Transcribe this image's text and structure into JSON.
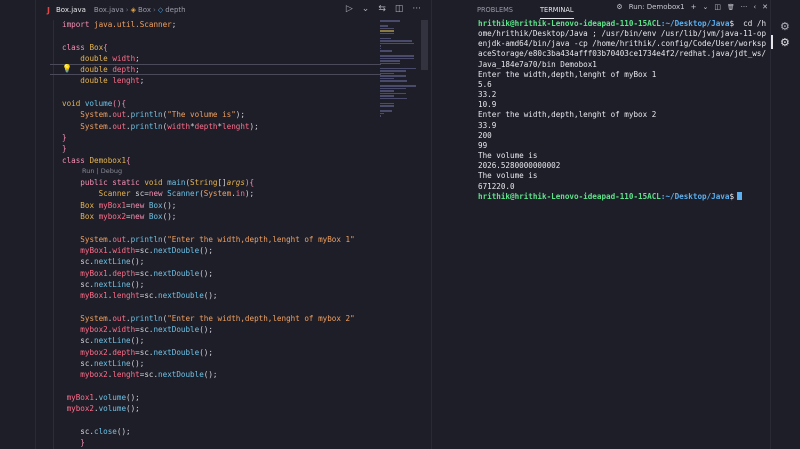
{
  "editor": {
    "tab": {
      "language_icon": "J",
      "file_name": "Box.java",
      "breadcrumb_file": "Box.java",
      "breadcrumb_class": "Box",
      "breadcrumb_field": "depth"
    },
    "actions": {
      "run_icon": "▷",
      "run_dropdown": "⌄",
      "compare_icon": "⇆",
      "split_icon": "◫",
      "more_icon": "···"
    },
    "codelens": "Run | Debug",
    "lines": [
      [
        {
          "c": "kw",
          "t": "import "
        },
        {
          "c": "cls",
          "t": "java.util.Scanner"
        },
        {
          "c": "op",
          "t": ";"
        }
      ],
      [],
      [
        {
          "c": "kw",
          "t": "class "
        },
        {
          "c": "ty",
          "t": "Box"
        },
        {
          "c": "brace",
          "t": "{"
        }
      ],
      [
        {
          "c": "op",
          "t": "    "
        },
        {
          "c": "kw2",
          "t": "double "
        },
        {
          "c": "vr",
          "t": "width"
        },
        {
          "c": "op",
          "t": ";"
        }
      ],
      [
        {
          "c": "op",
          "t": "    "
        },
        {
          "c": "kw2",
          "t": "double "
        },
        {
          "c": "vr",
          "t": "depth"
        },
        {
          "c": "op",
          "t": ";"
        }
      ],
      [
        {
          "c": "op",
          "t": "    "
        },
        {
          "c": "kw2",
          "t": "double "
        },
        {
          "c": "vr",
          "t": "lenght"
        },
        {
          "c": "op",
          "t": ";"
        }
      ],
      [],
      [
        {
          "c": "kw2",
          "t": "void "
        },
        {
          "c": "fn",
          "t": "volume"
        },
        {
          "c": "brace",
          "t": "(){"
        }
      ],
      [
        {
          "c": "op",
          "t": "    "
        },
        {
          "c": "cls",
          "t": "System"
        },
        {
          "c": "op",
          "t": "."
        },
        {
          "c": "vr",
          "t": "out"
        },
        {
          "c": "op",
          "t": "."
        },
        {
          "c": "fn",
          "t": "println"
        },
        {
          "c": "op",
          "t": "("
        },
        {
          "c": "st",
          "t": "\"The volume is\""
        },
        {
          "c": "op",
          "t": ");"
        }
      ],
      [
        {
          "c": "op",
          "t": "    "
        },
        {
          "c": "cls",
          "t": "System"
        },
        {
          "c": "op",
          "t": "."
        },
        {
          "c": "vr",
          "t": "out"
        },
        {
          "c": "op",
          "t": "."
        },
        {
          "c": "fn",
          "t": "println"
        },
        {
          "c": "op",
          "t": "("
        },
        {
          "c": "vr",
          "t": "width"
        },
        {
          "c": "op",
          "t": "*"
        },
        {
          "c": "vr",
          "t": "depth"
        },
        {
          "c": "op",
          "t": "*"
        },
        {
          "c": "vr",
          "t": "lenght"
        },
        {
          "c": "op",
          "t": ");"
        }
      ],
      [
        {
          "c": "brace",
          "t": "}"
        }
      ],
      [
        {
          "c": "brace",
          "t": "}"
        }
      ],
      [
        {
          "c": "kw",
          "t": "class "
        },
        {
          "c": "ty",
          "t": "Demobox1"
        },
        {
          "c": "brace",
          "t": "{"
        }
      ],
      "CODELENS",
      [
        {
          "c": "op",
          "t": "    "
        },
        {
          "c": "kw",
          "t": "public static "
        },
        {
          "c": "kw2",
          "t": "void "
        },
        {
          "c": "fn",
          "t": "main"
        },
        {
          "c": "op",
          "t": "("
        },
        {
          "c": "ty",
          "t": "String"
        },
        {
          "c": "op",
          "t": "[]"
        },
        {
          "c": "pr ital",
          "t": "args"
        },
        {
          "c": "brace",
          "t": "){"
        }
      ],
      [
        {
          "c": "op",
          "t": "        "
        },
        {
          "c": "ty",
          "t": "Scanner "
        },
        {
          "c": "op",
          "t": "sc="
        },
        {
          "c": "kw",
          "t": "new "
        },
        {
          "c": "fn",
          "t": "Scanner"
        },
        {
          "c": "op",
          "t": "("
        },
        {
          "c": "cls",
          "t": "System"
        },
        {
          "c": "op",
          "t": "."
        },
        {
          "c": "vr",
          "t": "in"
        },
        {
          "c": "op",
          "t": ");"
        }
      ],
      [
        {
          "c": "op",
          "t": "    "
        },
        {
          "c": "ty",
          "t": "Box "
        },
        {
          "c": "vr",
          "t": "myBox1"
        },
        {
          "c": "op",
          "t": "="
        },
        {
          "c": "kw",
          "t": "new "
        },
        {
          "c": "fn",
          "t": "Box"
        },
        {
          "c": "op",
          "t": "();"
        }
      ],
      [
        {
          "c": "op",
          "t": "    "
        },
        {
          "c": "ty",
          "t": "Box "
        },
        {
          "c": "vr",
          "t": "mybox2"
        },
        {
          "c": "op",
          "t": "="
        },
        {
          "c": "kw",
          "t": "new "
        },
        {
          "c": "fn",
          "t": "Box"
        },
        {
          "c": "op",
          "t": "();"
        }
      ],
      [],
      [
        {
          "c": "op",
          "t": "    "
        },
        {
          "c": "cls",
          "t": "System"
        },
        {
          "c": "op",
          "t": "."
        },
        {
          "c": "vr",
          "t": "out"
        },
        {
          "c": "op",
          "t": "."
        },
        {
          "c": "fn",
          "t": "println"
        },
        {
          "c": "op",
          "t": "("
        },
        {
          "c": "st",
          "t": "\"Enter the width,depth,lenght of myBox 1\""
        }
      ],
      [
        {
          "c": "op",
          "t": "    "
        },
        {
          "c": "vr",
          "t": "myBox1"
        },
        {
          "c": "op",
          "t": "."
        },
        {
          "c": "vr",
          "t": "width"
        },
        {
          "c": "op",
          "t": "=sc."
        },
        {
          "c": "fn",
          "t": "nextDouble"
        },
        {
          "c": "op",
          "t": "();"
        }
      ],
      [
        {
          "c": "op",
          "t": "    sc."
        },
        {
          "c": "fn",
          "t": "nextLine"
        },
        {
          "c": "op",
          "t": "();"
        }
      ],
      [
        {
          "c": "op",
          "t": "    "
        },
        {
          "c": "vr",
          "t": "myBox1"
        },
        {
          "c": "op",
          "t": "."
        },
        {
          "c": "vr",
          "t": "depth"
        },
        {
          "c": "op",
          "t": "=sc."
        },
        {
          "c": "fn",
          "t": "nextDouble"
        },
        {
          "c": "op",
          "t": "();"
        }
      ],
      [
        {
          "c": "op",
          "t": "    sc."
        },
        {
          "c": "fn",
          "t": "nextLine"
        },
        {
          "c": "op",
          "t": "();"
        }
      ],
      [
        {
          "c": "op",
          "t": "    "
        },
        {
          "c": "vr",
          "t": "myBox1"
        },
        {
          "c": "op",
          "t": "."
        },
        {
          "c": "vr",
          "t": "lenght"
        },
        {
          "c": "op",
          "t": "=sc."
        },
        {
          "c": "fn",
          "t": "nextDouble"
        },
        {
          "c": "op",
          "t": "();"
        }
      ],
      [],
      [
        {
          "c": "op",
          "t": "    "
        },
        {
          "c": "cls",
          "t": "System"
        },
        {
          "c": "op",
          "t": "."
        },
        {
          "c": "vr",
          "t": "out"
        },
        {
          "c": "op",
          "t": "."
        },
        {
          "c": "fn",
          "t": "println"
        },
        {
          "c": "op",
          "t": "("
        },
        {
          "c": "st",
          "t": "\"Enter the width,depth,lenght of mybox 2\""
        }
      ],
      [
        {
          "c": "op",
          "t": "    "
        },
        {
          "c": "vr",
          "t": "mybox2"
        },
        {
          "c": "op",
          "t": "."
        },
        {
          "c": "vr",
          "t": "width"
        },
        {
          "c": "op",
          "t": "=sc."
        },
        {
          "c": "fn",
          "t": "nextDouble"
        },
        {
          "c": "op",
          "t": "();"
        }
      ],
      [
        {
          "c": "op",
          "t": "    sc."
        },
        {
          "c": "fn",
          "t": "nextLine"
        },
        {
          "c": "op",
          "t": "();"
        }
      ],
      [
        {
          "c": "op",
          "t": "    "
        },
        {
          "c": "vr",
          "t": "mybox2"
        },
        {
          "c": "op",
          "t": "."
        },
        {
          "c": "vr",
          "t": "depth"
        },
        {
          "c": "op",
          "t": "=sc."
        },
        {
          "c": "fn",
          "t": "nextDouble"
        },
        {
          "c": "op",
          "t": "();"
        }
      ],
      [
        {
          "c": "op",
          "t": "    sc."
        },
        {
          "c": "fn",
          "t": "nextLine"
        },
        {
          "c": "op",
          "t": "();"
        }
      ],
      [
        {
          "c": "op",
          "t": "    "
        },
        {
          "c": "vr",
          "t": "mybox2"
        },
        {
          "c": "op",
          "t": "."
        },
        {
          "c": "vr",
          "t": "lenght"
        },
        {
          "c": "op",
          "t": "=sc."
        },
        {
          "c": "fn",
          "t": "nextDouble"
        },
        {
          "c": "op",
          "t": "();"
        }
      ],
      [],
      [
        {
          "c": "op",
          "t": " "
        },
        {
          "c": "vr",
          "t": "myBox1"
        },
        {
          "c": "op",
          "t": "."
        },
        {
          "c": "fn",
          "t": "volume"
        },
        {
          "c": "op",
          "t": "();"
        }
      ],
      [
        {
          "c": "op",
          "t": " "
        },
        {
          "c": "vr",
          "t": "mybox2"
        },
        {
          "c": "op",
          "t": "."
        },
        {
          "c": "fn",
          "t": "volume"
        },
        {
          "c": "op",
          "t": "();"
        }
      ],
      [],
      [
        {
          "c": "op",
          "t": "    sc."
        },
        {
          "c": "fn",
          "t": "close"
        },
        {
          "c": "op",
          "t": "();"
        }
      ],
      [
        {
          "c": "op",
          "t": "    "
        },
        {
          "c": "brace",
          "t": "}"
        }
      ],
      [
        {
          "c": "brace",
          "t": "}"
        }
      ]
    ]
  },
  "terminal": {
    "tabs": [
      "PROBLEMS",
      "TERMINAL"
    ],
    "active_tab": "TERMINAL",
    "toolbar": {
      "settings_icon": "⚙",
      "launch_name": "Run: Demobox1",
      "add_icon": "+",
      "dropdown_icon": "⌄",
      "split_icon": "◫",
      "trash_icon": "🗑",
      "more_icon": "···",
      "back_icon": "‹",
      "close_icon": "✕"
    },
    "prompt_user": "hrithik@hrithik-Lenovo-ideapad-110-15ACL",
    "prompt_path": ":~/Desktop/Java",
    "prompt_symbol": "$",
    "command": "  cd /home/hrithik/Desktop/Java ; /usr/bin/env /usr/lib/jvm/java-11-openjdk-amd64/bin/java -cp /home/hrithik/.config/Code/User/workspaceStorage/e80c3ba434afff03b70403ce1734e4f2/redhat.java/jdt_ws/Java_184e7a70/bin Demobox1",
    "output": "Enter the width,depth,lenght of myBox 1\n5.6\n33.2\n10.9\nEnter the width,depth,lenght of mybox 2\n33.9\n200\n99\nThe volume is\n2026.5280000000002\nThe volume is\n671220.0"
  },
  "colors": {
    "background": "#1e1e28",
    "prompt_user": "#5ee38a",
    "prompt_path": "#5ab0f0",
    "keyword": "#f58fb2",
    "string": "#f0a060"
  }
}
